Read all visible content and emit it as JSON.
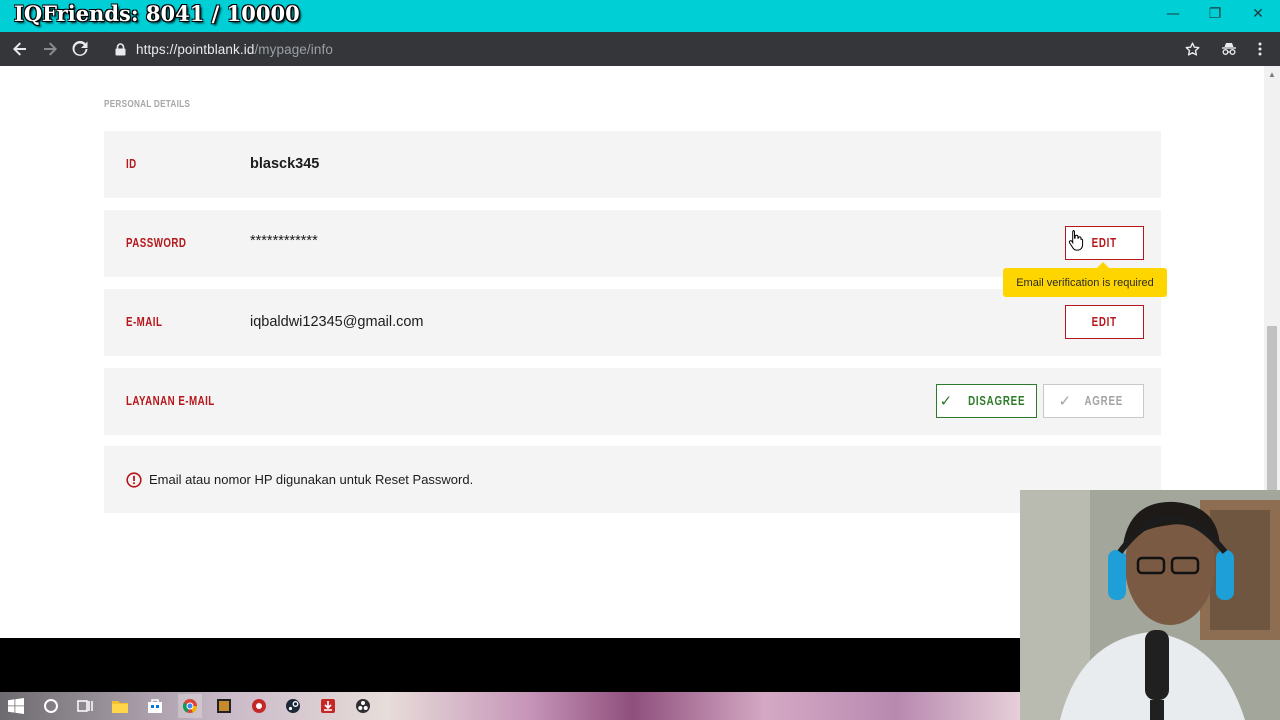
{
  "window": {
    "overlay_text": "IQFriends: 8041 / 10000",
    "controls": {
      "minimize": "—",
      "restore": "❐",
      "close": "✕"
    }
  },
  "browser": {
    "back_icon": "back-arrow-icon",
    "forward_icon": "forward-arrow-icon",
    "reload_icon": "reload-icon",
    "url_host": "https://pointblank.id",
    "url_path": "/mypage/info",
    "right_icons": [
      "star-icon",
      "incognito-icon",
      "kebab-menu-icon"
    ]
  },
  "page": {
    "section_title": "PERSONAL DETAILS",
    "rows": {
      "id": {
        "label": "ID",
        "value": "blasck345"
      },
      "password": {
        "label": "PASSWORD",
        "value": "************",
        "edit_label": "EDIT"
      },
      "email": {
        "label": "E-MAIL",
        "value": "iqbaldwi12345@gmail.com",
        "edit_label": "EDIT"
      },
      "email_service": {
        "label": "LAYANAN E-MAIL",
        "disagree_label": "DISAGREE",
        "agree_label": "AGREE"
      }
    },
    "tooltip": "Email verification is required",
    "notice": "Email atau nomor HP digunakan untuk Reset Password."
  },
  "colors": {
    "titlebar": "#00cfd6",
    "addressbar": "#35363a",
    "label_red": "#b5171b",
    "disagree_green": "#2d7a2a",
    "tooltip_yellow": "#ffd500",
    "row_bg": "#f4f4f4"
  },
  "taskbar_icons": [
    "windows-start-icon",
    "cortana-icon",
    "task-view-icon",
    "file-explorer-icon",
    "store-icon",
    "chrome-icon",
    "video-editor-icon",
    "record-icon",
    "steam-icon",
    "download-app-icon",
    "obs-icon"
  ]
}
